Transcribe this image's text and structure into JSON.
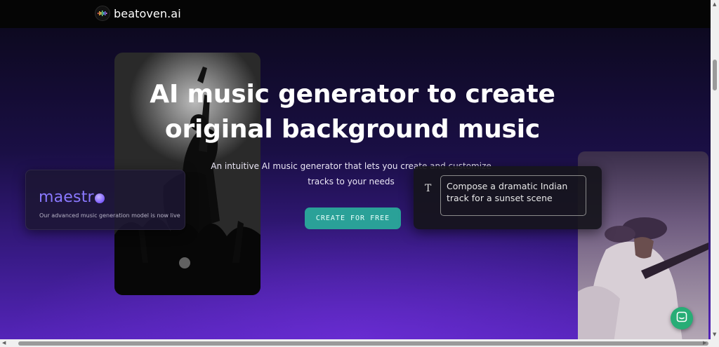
{
  "nav": {
    "logo_text": "beatoven.ai",
    "logo_icon": "waveform-logo-icon"
  },
  "hero": {
    "title": "AI music generator to create original background music",
    "subtitle": "An intuitive AI music generator that lets you create and customize tracks to your needs",
    "cta_label": "CREATE FOR FREE",
    "cta_color": "#2aa198"
  },
  "maestro": {
    "brand": "maestr",
    "tagline": "Our advanced music generation model is now live",
    "accent": "#8a78ff"
  },
  "prompt_card": {
    "prefix": "T",
    "text": "Compose a dramatic Indian track for a sunset scene"
  },
  "chat": {
    "icon": "chat-bubble-icon",
    "color": "#27ad76"
  },
  "colors": {
    "background_top": "#0d0920",
    "background_bottom": "#5424b8",
    "navbar": "#050505"
  }
}
